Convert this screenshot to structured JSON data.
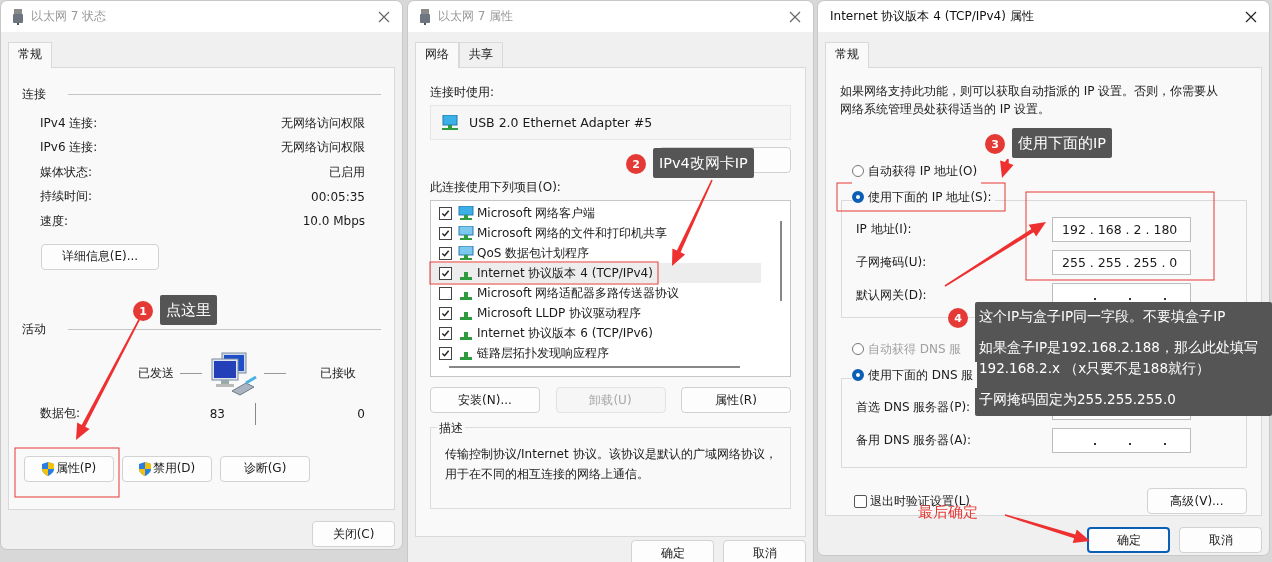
{
  "status_window": {
    "title": "以太网 7 状态",
    "active": false,
    "tabs": [
      {
        "label": "常规",
        "selected": true
      }
    ],
    "connection_heading": "连接",
    "rows": [
      {
        "label": "IPv4 连接:",
        "value": "无网络访问权限"
      },
      {
        "label": "IPv6 连接:",
        "value": "无网络访问权限"
      },
      {
        "label": "媒体状态:",
        "value": "已启用"
      },
      {
        "label": "持续时间:",
        "value": "00:05:35"
      },
      {
        "label": "速度:",
        "value": "10.0 Mbps"
      }
    ],
    "details_button": "详细信息(E)...",
    "activity_heading": "活动",
    "sent_label": "已发送",
    "received_label": "已接收",
    "packets": {
      "label": "数据包:",
      "sent": "83",
      "received": "0"
    },
    "buttons": [
      {
        "label": "属性(P)",
        "shield": true
      },
      {
        "label": "禁用(D)",
        "shield": true
      },
      {
        "label": "诊断(G)",
        "shield": false
      }
    ],
    "close_button": "关闭(C)"
  },
  "properties_window": {
    "title": "以太网 7 属性",
    "active": false,
    "tabs": [
      {
        "label": "网络",
        "selected": true
      },
      {
        "label": "共享",
        "selected": false
      }
    ],
    "connect_using_label": "连接时使用:",
    "adapter": "USB 2.0 Ethernet Adapter #5",
    "items_label": "此连接使用下列项目(O):",
    "items": [
      {
        "label": "Microsoft 网络客户端",
        "checked": true,
        "kind": "client",
        "selected": false
      },
      {
        "label": "Microsoft 网络的文件和打印机共享",
        "checked": true,
        "kind": "service",
        "selected": false
      },
      {
        "label": "QoS 数据包计划程序",
        "checked": true,
        "kind": "service",
        "selected": false
      },
      {
        "label": "Internet 协议版本 4 (TCP/IPv4)",
        "checked": true,
        "kind": "protocol",
        "selected": true
      },
      {
        "label": "Microsoft 网络适配器多路传送器协议",
        "checked": false,
        "kind": "protocol",
        "selected": false
      },
      {
        "label": "Microsoft LLDP 协议驱动程序",
        "checked": true,
        "kind": "protocol",
        "selected": false
      },
      {
        "label": "Internet 协议版本 6 (TCP/IPv6)",
        "checked": true,
        "kind": "protocol",
        "selected": false
      },
      {
        "label": "链路层拓扑发现响应程序",
        "checked": true,
        "kind": "protocol",
        "selected": false
      }
    ],
    "buttons": [
      {
        "label": "安装(N)...",
        "disabled": false
      },
      {
        "label": "卸载(U)",
        "disabled": true
      },
      {
        "label": "属性(R)",
        "disabled": false
      }
    ],
    "description_title": "描述",
    "description": "传输控制协议/Internet 协议。该协议是默认的广域网络协议，用于在不同的相互连接的网络上通信。",
    "ok_button": "确定",
    "cancel_button": "取消"
  },
  "ipv4_window": {
    "title": "Internet 协议版本 4 (TCP/IPv4) 属性",
    "active": true,
    "tabs": [
      {
        "label": "常规",
        "selected": true
      }
    ],
    "intro": "如果网络支持此功能，则可以获取自动指派的 IP 设置。否则，你需要从网络系统管理员处获得适当的 IP 设置。",
    "ip_options": [
      {
        "label": "自动获得 IP 地址(O)",
        "selected": false
      },
      {
        "label": "使用下面的 IP 地址(S):",
        "selected": true
      }
    ],
    "ip_fields": [
      {
        "label": "IP 地址(I):",
        "value": "192 . 168 . 2 . 180"
      },
      {
        "label": "子网掩码(U):",
        "value": "255 . 255 . 255 . 0"
      },
      {
        "label": "默认网关(D):"
      }
    ],
    "dns_options": [
      {
        "label": "自动获得 DNS 服",
        "selected": false,
        "disabled": true
      },
      {
        "label": "使用下面的 DNS 服",
        "selected": true,
        "disabled": false
      }
    ],
    "dns_fields": [
      {
        "label": "首选 DNS 服务器(P):"
      },
      {
        "label": "备用 DNS 服务器(A):"
      }
    ],
    "validate": {
      "label": "退出时验证设置(L)",
      "checked": false
    },
    "advanced_button": "高级(V)...",
    "ok_button": "确定",
    "cancel_button": "取消"
  },
  "annotations": [
    {
      "number": "1",
      "lines": [
        "点这里"
      ]
    },
    {
      "number": "2",
      "lines": [
        "IPv4改网卡IP"
      ]
    },
    {
      "number": "3",
      "lines": [
        "使用下面的IP"
      ]
    },
    {
      "number": "4",
      "lines": [
        "这个IP与盒子IP同一字段。不要填盒子IP",
        "如果盒子IP是192.168.2.188，那么此处填写192.168.2.x （x只要不是188就行）",
        "子网掩码固定为255.255.255.0"
      ]
    }
  ],
  "final_note": "最后确定"
}
